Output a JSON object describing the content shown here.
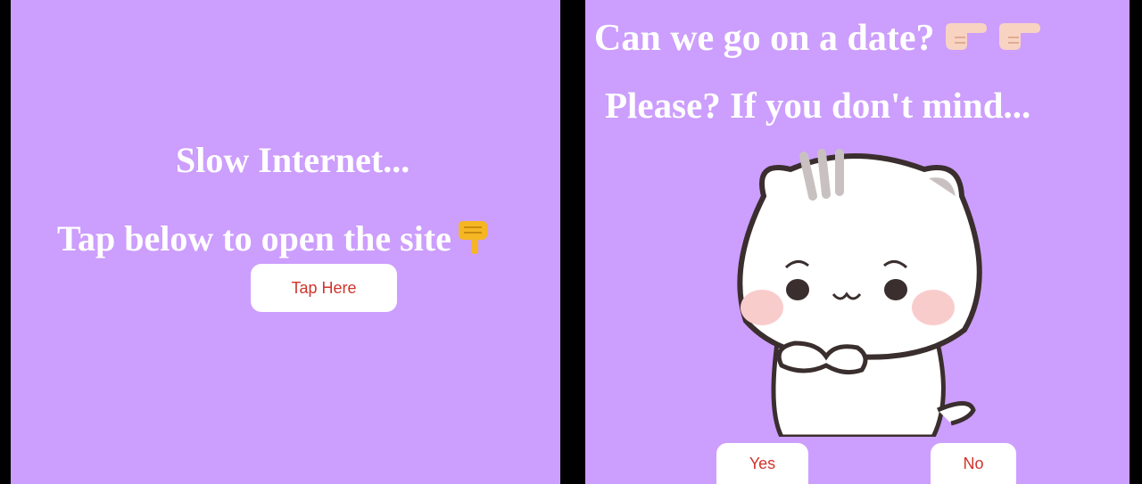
{
  "colors": {
    "background": "#cc9efd",
    "button_text": "#d0342c",
    "heading_text": "#ffffff"
  },
  "left_screen": {
    "title": "Slow Internet...",
    "instruction": "Tap below to open the site",
    "instruction_icon": "pointing-down-hand-icon",
    "button_label": "Tap Here"
  },
  "right_screen": {
    "question": "Can we go on a date?",
    "question_icons": [
      "pointing-right-hand-icon",
      "pointing-right-hand-icon"
    ],
    "subline": "Please? If you don't mind...",
    "illustration": "shy-cat-icon",
    "yes_label": "Yes",
    "no_label": "No"
  }
}
